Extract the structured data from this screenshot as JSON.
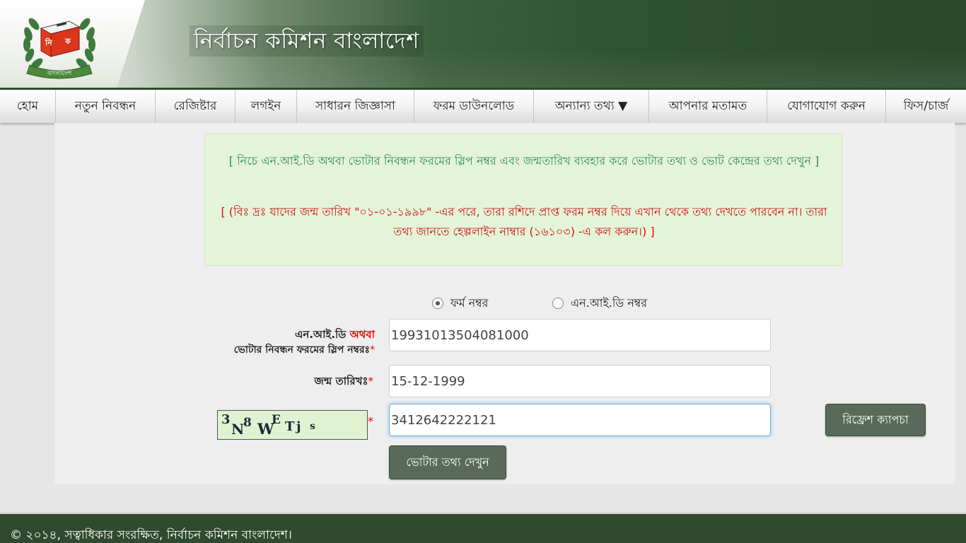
{
  "header": {
    "title": "নির্বাচন কমিশন বাংলাদেশ",
    "logo_top_text": "নি ক",
    "logo_ribbon_text": "বাংলাদেশ"
  },
  "nav": {
    "items": [
      {
        "label": "হোম"
      },
      {
        "label": "নতুন নিবন্ধন"
      },
      {
        "label": "রেজিষ্টার"
      },
      {
        "label": "লগইন"
      },
      {
        "label": "সাধারন জিজ্ঞাসা"
      },
      {
        "label": "ফরম ডাউনলোড"
      },
      {
        "label": "অন্যান্য তথ্য ▼"
      },
      {
        "label": "আপনার মতামত"
      },
      {
        "label": "যোগাযোগ করুন"
      },
      {
        "label": "ফিস/চার্জ"
      }
    ]
  },
  "notice": {
    "info": "[ নিচে এন.আই.ডি অথবা ভোটার নিবন্ধন ফরমের স্লিপ নম্বর এবং জন্মতারিখ ব্যবহার করে ভোটার তথ্য ও ভোট কেন্দ্রের তথ্য দেখুন ]",
    "warning": "[ (বিঃ দ্রঃ যাদের জন্ম তারিখ \"০১-০১-১৯৯৮\" -এর পরে, তারা রশিদে প্রাপ্ত ফরম নম্বর দিয়ে এখান থেকে তথ্য দেখতে পারবেন না। তারা তথ্য জানতে হেল্পলাইন নাম্বার (১৬১০৩) -এ কল করুন।) ]"
  },
  "form": {
    "radio_form_label": "ফর্ম নম্বর",
    "radio_nid_label": "এন.আই.ডি নম্বর",
    "radio_selected": "form",
    "id_label_line1": "এন.আই.ডি",
    "id_label_or": "অথবা",
    "id_label_line2": "ভোটার নিবন্ধন ফরমের স্লিপ নম্বরঃ",
    "id_value": "19931013504081000",
    "dob_label": "জন্ম তারিখঃ",
    "dob_value": "15-12-1999",
    "required_mark": "*",
    "captcha_chars": [
      "3",
      "N",
      "8",
      "W",
      "E",
      "T",
      "j",
      "s"
    ],
    "captcha_value": "3412642222121",
    "refresh_captcha_label": "রিফ্রেশ ক্যাপচা",
    "submit_label": "ভোটার তথ্য দেখুন"
  },
  "footer": {
    "copyright": "© ২০১৪, সত্বাধিকার সংরক্ষিত, নির্বাচন কমিশন বাংলাদেশ।"
  },
  "colors": {
    "header_dark_green": "#2a4a2a",
    "notice_bg": "#e4f4d9",
    "info_text": "#2f8a5a",
    "warning_text": "#d01010",
    "button_bg": "#5a6a5a"
  }
}
